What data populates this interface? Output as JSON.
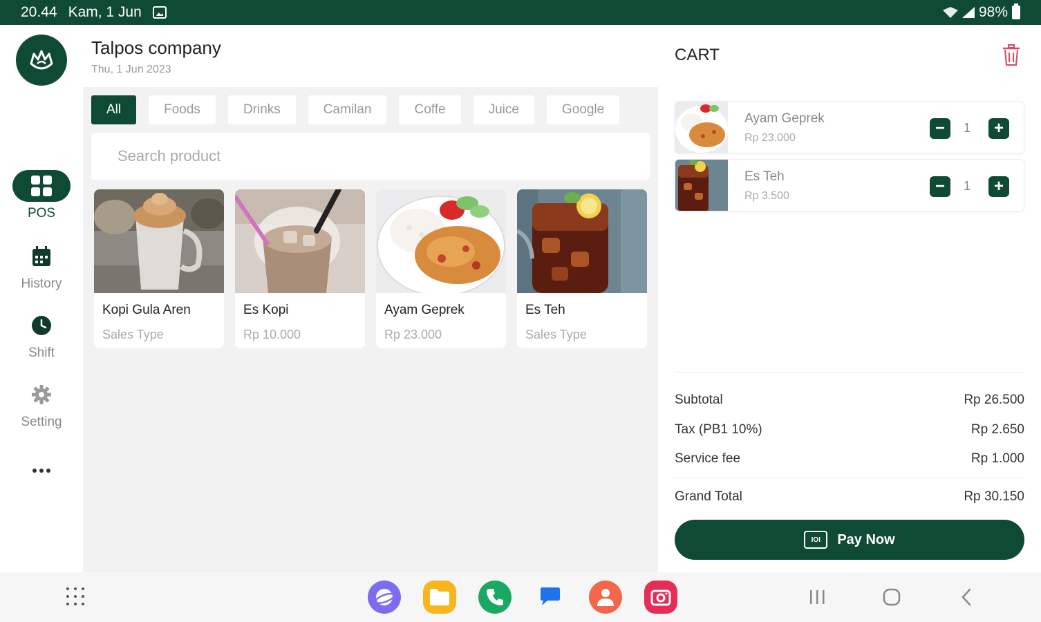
{
  "status_bar": {
    "time": "20.44",
    "date": "Kam, 1 Jun",
    "battery": "98%"
  },
  "header": {
    "company": "Talpos company",
    "date": "Thu, 1 Jun 2023"
  },
  "sidebar": {
    "items": [
      {
        "label": "POS",
        "icon": "grid-icon"
      },
      {
        "label": "History",
        "icon": "calendar-icon"
      },
      {
        "label": "Shift",
        "icon": "clock-icon"
      },
      {
        "label": "Setting",
        "icon": "gear-icon"
      }
    ]
  },
  "categories": [
    "All",
    "Foods",
    "Drinks",
    "Camilan",
    "Coffe",
    "Juice",
    "Google"
  ],
  "search": {
    "placeholder": "Search product"
  },
  "products": [
    {
      "name": "Kopi Gula Aren",
      "sub": "Sales Type"
    },
    {
      "name": "Es Kopi",
      "sub": "Rp 10.000"
    },
    {
      "name": "Ayam Geprek",
      "sub": "Rp 23.000"
    },
    {
      "name": "Es Teh",
      "sub": "Sales Type"
    }
  ],
  "cart": {
    "title": "CART",
    "items": [
      {
        "name": "Ayam Geprek",
        "price": "Rp 23.000",
        "qty": "1"
      },
      {
        "name": "Es Teh",
        "price": "Rp 3.500",
        "qty": "1"
      }
    ],
    "summary": {
      "subtotal_label": "Subtotal",
      "subtotal": "Rp 26.500",
      "tax_label": "Tax (PB1 10%)",
      "tax": "Rp 2.650",
      "service_label": "Service fee",
      "service": "Rp 1.000",
      "grand_label": "Grand Total",
      "grand": "Rp 30.150"
    },
    "pay_label": "Pay Now",
    "pay_icon_text": "IOI"
  },
  "colors": {
    "primary": "#0f4a35",
    "danger": "#e2445c"
  }
}
